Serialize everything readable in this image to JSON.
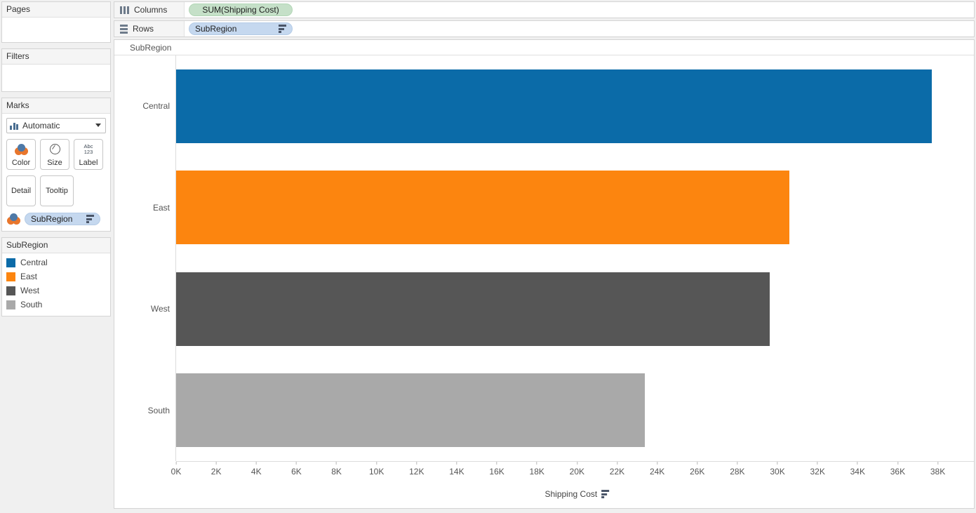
{
  "left_panel": {
    "pages": {
      "title": "Pages"
    },
    "filters": {
      "title": "Filters"
    },
    "marks": {
      "title": "Marks",
      "mark_type": "Automatic",
      "mark_type_icon": "bar-chart-icon",
      "buttons": [
        {
          "label": "Color",
          "icon": "color-palette-icon"
        },
        {
          "label": "Size",
          "icon": "size-circle-icon"
        },
        {
          "label": "Label",
          "icon": "abc-123-icon",
          "icon_top": "Abc",
          "icon_bottom": "123"
        },
        {
          "label": "Detail",
          "icon": ""
        },
        {
          "label": "Tooltip",
          "icon": ""
        }
      ],
      "pill": {
        "label": "SubRegion",
        "icon": "color-palette-icon",
        "sort_icon": "sort-descending-icon"
      }
    },
    "legend": {
      "title": "SubRegion",
      "items": [
        {
          "label": "Central",
          "color": "#0b6ba8"
        },
        {
          "label": "East",
          "color": "#fc850f"
        },
        {
          "label": "West",
          "color": "#565656"
        },
        {
          "label": "South",
          "color": "#a9a9a9"
        }
      ]
    }
  },
  "shelves": {
    "columns": {
      "label": "Columns",
      "icon": "columns-icon",
      "pill": "SUM(Shipping Cost)"
    },
    "rows": {
      "label": "Rows",
      "icon": "rows-icon",
      "pill": "SubRegion",
      "sort_icon": "sort-descending-icon"
    }
  },
  "viz": {
    "column_header": "SubRegion",
    "axis_title": "Shipping Cost",
    "axis_sort_icon": "sort-descending-icon"
  },
  "chart_data": {
    "type": "bar",
    "title": "",
    "orientation": "horizontal",
    "categories": [
      "Central",
      "East",
      "West",
      "South"
    ],
    "values": [
      37700,
      30600,
      29600,
      23400
    ],
    "colors": [
      "#0b6ba8",
      "#fc850f",
      "#565656",
      "#a9a9a9"
    ],
    "xlabel": "Shipping Cost",
    "ylabel": "SubRegion",
    "xlim": [
      0,
      39800
    ],
    "tick_labels": [
      "0K",
      "2K",
      "4K",
      "6K",
      "8K",
      "10K",
      "12K",
      "14K",
      "16K",
      "18K",
      "20K",
      "22K",
      "24K",
      "26K",
      "28K",
      "30K",
      "32K",
      "34K",
      "36K",
      "38K"
    ],
    "tick_values": [
      0,
      2000,
      4000,
      6000,
      8000,
      10000,
      12000,
      14000,
      16000,
      18000,
      20000,
      22000,
      24000,
      26000,
      28000,
      30000,
      32000,
      34000,
      36000,
      38000
    ],
    "grid": false,
    "legend": "left",
    "series": [
      {
        "name": "SubRegion",
        "values": [
          37700,
          30600,
          29600,
          23400
        ]
      }
    ]
  }
}
